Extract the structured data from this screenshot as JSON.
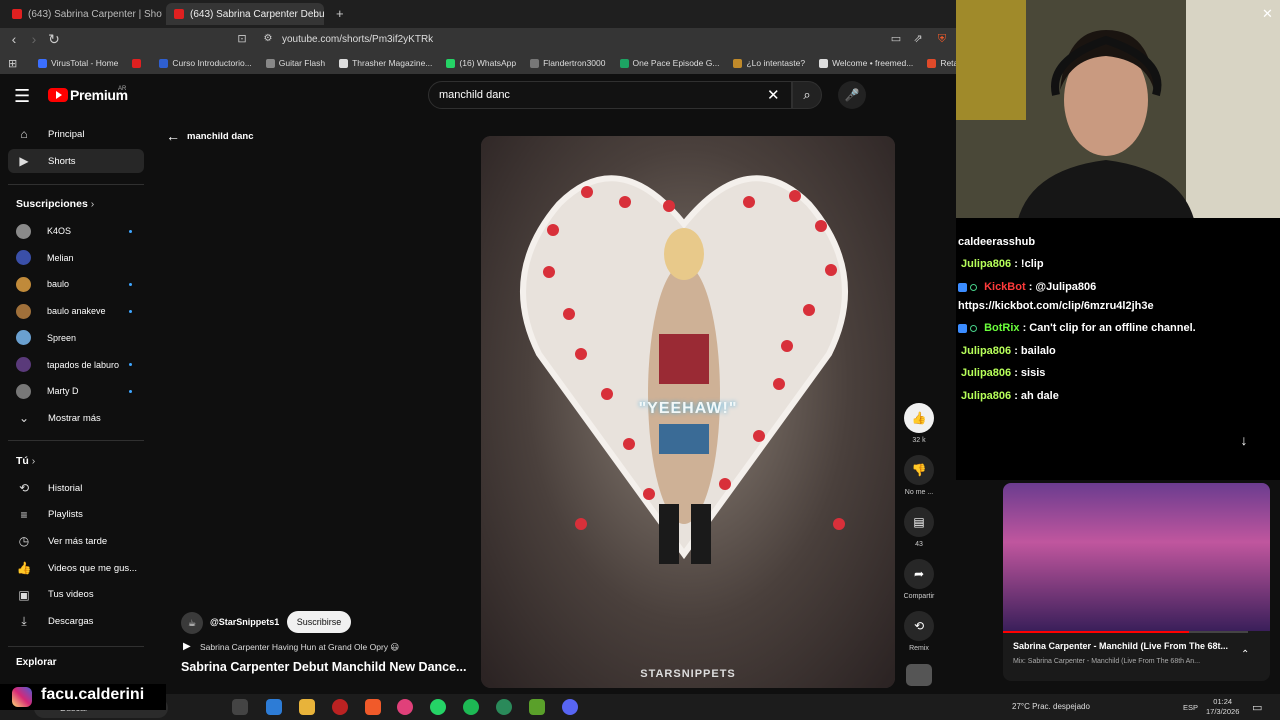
{
  "browser": {
    "tabs": [
      {
        "label": "(643) Sabrina Carpenter | Show Comp"
      },
      {
        "label": "(643) Sabrina Carpenter Debu"
      }
    ],
    "url": "youtube.com/shorts/Pm3if2yKTRk",
    "bookmarks": [
      {
        "label": "VirusTotal - Home",
        "color": "#3b6fff"
      },
      {
        "label": "",
        "color": "#e02020"
      },
      {
        "label": "Curso Introductorio...",
        "color": "#2f5fd0"
      },
      {
        "label": "Guitar Flash",
        "color": "#888"
      },
      {
        "label": "Thrasher Magazine...",
        "color": "#ddd"
      },
      {
        "label": "(16) WhatsApp",
        "color": "#25d366"
      },
      {
        "label": "Flandertron3000",
        "color": "#777"
      },
      {
        "label": "One Pace Episode G...",
        "color": "#1da363"
      },
      {
        "label": "¿Lo intentaste?",
        "color": "#c08a2a"
      },
      {
        "label": "Welcome • freemed...",
        "color": "#ddd"
      },
      {
        "label": "Retakes CS",
        "color": "#e04a2a"
      }
    ]
  },
  "header": {
    "logo_text": "Premium",
    "logo_region": "AR",
    "search_value": "manchild danc"
  },
  "sidebar": {
    "main_items": [
      {
        "label": "Principal",
        "icon": "home-icon"
      },
      {
        "label": "Shorts",
        "icon": "shorts-icon"
      }
    ],
    "subscriptions_title": "Suscripciones",
    "subscriptions": [
      {
        "label": "K4OS",
        "color": "#8a8a8a",
        "dot": true
      },
      {
        "label": "Melian",
        "color": "#3a4fa8",
        "dot": false
      },
      {
        "label": "baulo",
        "color": "#c08a3a",
        "dot": true
      },
      {
        "label": "baulo anakeve",
        "color": "#a0703a",
        "dot": true
      },
      {
        "label": "Spreen",
        "color": "#6aa0d0",
        "dot": false
      },
      {
        "label": "tapados de laburo",
        "color": "#5a3a7a",
        "dot": true
      },
      {
        "label": "Marty D",
        "color": "#777",
        "dot": true
      }
    ],
    "show_more": "Mostrar más",
    "you_title": "Tú",
    "you_items": [
      {
        "label": "Historial",
        "icon": "history-icon"
      },
      {
        "label": "Playlists",
        "icon": "playlists-icon"
      },
      {
        "label": "Ver más tarde",
        "icon": "watch-later-icon"
      },
      {
        "label": "Videos que me gus...",
        "icon": "like-icon"
      },
      {
        "label": "Tus videos",
        "icon": "your-videos-icon"
      },
      {
        "label": "Descargas",
        "icon": "download-icon"
      }
    ],
    "explore_title": "Explorar"
  },
  "shorts": {
    "back_query": "manchild danc",
    "caption": "\"YEEHAW!\"",
    "watermark": "STARSNIPPETS",
    "actions": {
      "like_count": "32 k",
      "dislike_label": "No me ...",
      "comments_count": "43",
      "share_label": "Compartir",
      "remix_label": "Remix"
    },
    "channel": "@StarSnippets1",
    "subscribe_label": "Suscribirse",
    "sound_title": "Sabrina Carpenter Having Hun at Grand Ole Opry 😃",
    "title": "Sabrina Carpenter Debut Manchild New Dance..."
  },
  "chat": {
    "partial_top": "caldeerasshub",
    "lines": [
      {
        "user": "Julipa806",
        "text": ": !clip",
        "kind": "user"
      },
      {
        "user": "KickBot",
        "text": ": @Julipa806",
        "kind": "bot"
      },
      {
        "user": "",
        "text": "https://kickbot.com/clip/6mzru4l2jh3e",
        "kind": "cont"
      },
      {
        "user": "BotRix",
        "text": ": Can't clip for an offline channel.",
        "kind": "bot2"
      },
      {
        "user": "Julipa806",
        "text": ": bailalo",
        "kind": "user"
      },
      {
        "user": "Julipa806",
        "text": ": sisis",
        "kind": "user"
      },
      {
        "user": "Julipa806",
        "text": ": ah dale",
        "kind": "user"
      }
    ]
  },
  "mini_player": {
    "title": "Sabrina Carpenter - Manchild (Live From The 68t...",
    "subtitle": "Mix: Sabrina Carpenter - Manchild (Live From The 68th An...",
    "progress": 0.76
  },
  "streamer": {
    "name": "facu.calderini"
  },
  "taskbar": {
    "search_placeholder": "Buscar",
    "weather": "27°C  Prac. despejado",
    "language": "ESP",
    "time": "01:24",
    "date": "17/3/2026"
  }
}
